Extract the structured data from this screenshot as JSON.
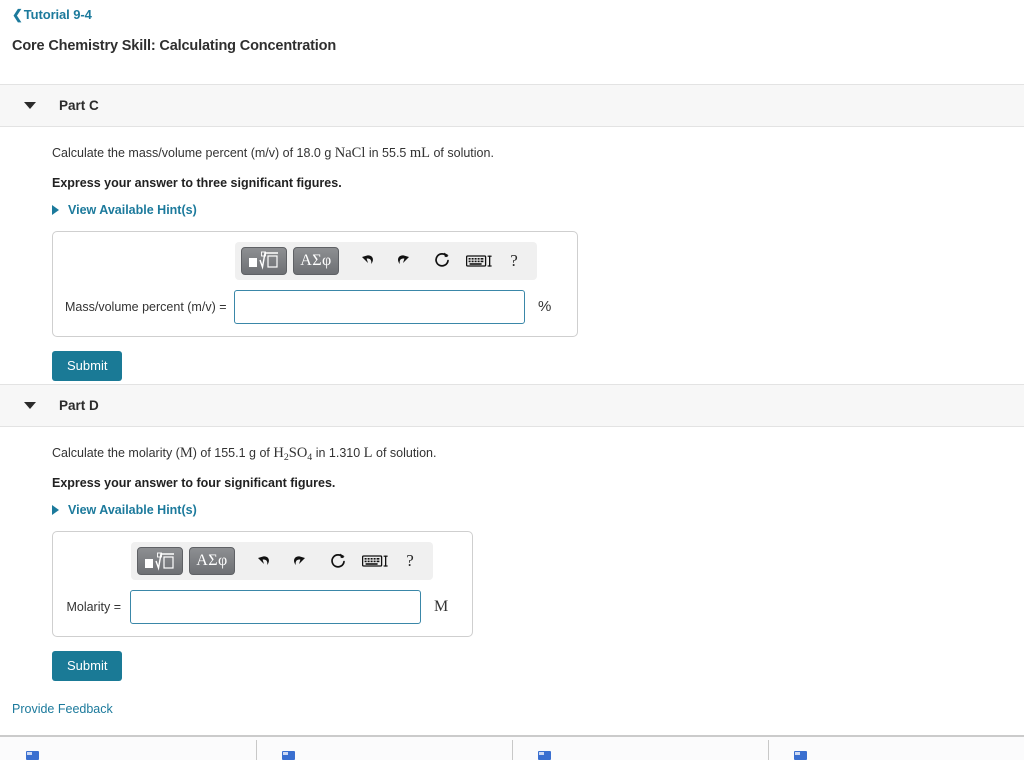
{
  "breadcrumb": {
    "back_icon": "chevron-left-icon",
    "label": "Tutorial 9-4"
  },
  "page_title": "Core Chemistry Skill: Calculating Concentration",
  "colors": {
    "link": "#1c7a9c",
    "submit_bg": "#1a7a96",
    "input_border": "#3a87a8",
    "part_header_bg": "#f7f7f7"
  },
  "toolbar": {
    "template_button_label": "template-math-icon",
    "greek_button_label": "ΑΣφ",
    "undo_icon": "undo-arrow-icon",
    "redo_icon": "redo-arrow-icon",
    "reset_icon": "reset-circular-arrow-icon",
    "keyboard_icon": "keyboard-icon",
    "help_label": "?"
  },
  "parts": [
    {
      "id": "part-c",
      "label": "Part C",
      "toggle_icon": "triangle-down-icon",
      "question_pre": "Calculate the mass/volume percent (m/v) of 18.0 g ",
      "question_formula": "NaCl",
      "question_mid": " in 55.5 ",
      "question_unit": "mL",
      "question_post": " of solution.",
      "instruction": "Express your answer to three significant figures.",
      "hints_label": "View Available Hint(s)",
      "input_label": "Mass/volume percent (m/v) =",
      "input_value": "",
      "input_placeholder": "",
      "unit": "%",
      "submit_label": "Submit"
    },
    {
      "id": "part-d",
      "label": "Part D",
      "toggle_icon": "triangle-down-icon",
      "question_pre": "Calculate the molarity (",
      "question_symbol": "M",
      "question_pre2": ") of 155.1 g of ",
      "question_formula_h": "H",
      "question_formula_h_sub": "2",
      "question_formula_so": "SO",
      "question_formula_so_sub": "4",
      "question_mid": " in 1.310 ",
      "question_unit": "L",
      "question_post": " of solution.",
      "instruction": "Express your answer to four significant figures.",
      "hints_label": "View Available Hint(s)",
      "input_label": "Molarity =",
      "input_value": "",
      "input_placeholder": "",
      "unit": "M",
      "submit_label": "Submit"
    }
  ],
  "feedback_label": "Provide Feedback",
  "footer": {
    "items": [
      {
        "icon": "app-icon"
      },
      {
        "icon": "app-icon"
      },
      {
        "icon": "app-icon"
      },
      {
        "icon": "app-icon"
      }
    ]
  }
}
